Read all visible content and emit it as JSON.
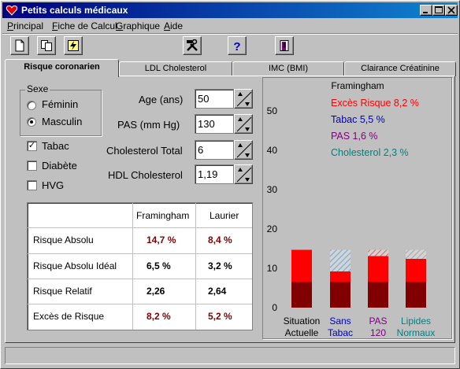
{
  "window": {
    "title": "Petits calculs médicaux"
  },
  "menu": [
    {
      "label": "Principal",
      "ul": "P"
    },
    {
      "label": "Fiche de Calcul",
      "ul": "F"
    },
    {
      "label": "Graphique",
      "ul": "G"
    },
    {
      "label": "Aide",
      "ul": "A"
    }
  ],
  "toolbar": [
    "new-document-icon",
    "copy-icon",
    "lightning-icon",
    "tools-icon",
    "help-question-icon",
    "exit-door-icon"
  ],
  "tabs": [
    {
      "label": "Risque coronarien",
      "active": true
    },
    {
      "label": "LDL Cholesterol",
      "active": false
    },
    {
      "label": "IMC (BMI)",
      "active": false
    },
    {
      "label": "Clairance Créatinine",
      "active": false
    }
  ],
  "sexe": {
    "label": "Sexe",
    "options": [
      {
        "label": "Féminin",
        "selected": false
      },
      {
        "label": "Masculin",
        "selected": true
      }
    ]
  },
  "checkboxes": [
    {
      "label": "Tabac",
      "checked": true
    },
    {
      "label": "Diabète",
      "checked": false
    },
    {
      "label": "HVG",
      "checked": false
    }
  ],
  "inputs": [
    {
      "label": "Age (ans)",
      "value": "50"
    },
    {
      "label": "PAS (mm Hg)",
      "value": "130"
    },
    {
      "label": "Cholesterol Total",
      "value": "6"
    },
    {
      "label": "HDL Cholesterol",
      "value": "1,19"
    }
  ],
  "results": {
    "headers": [
      "Framingham",
      "Laurier"
    ],
    "rows": [
      {
        "label": "Risque Absolu",
        "framingham": "14,7 %",
        "laurier": "8,4 %",
        "highlight": true
      },
      {
        "label": "Risque Absolu Idéal",
        "framingham": "6,5 %",
        "laurier": "3,2 %",
        "highlight": false
      },
      {
        "label": "Risque Relatif",
        "framingham": "2,26",
        "laurier": "2,64",
        "highlight": false
      },
      {
        "label": "Excès de Risque",
        "framingham": "8,2 %",
        "laurier": "5,2 %",
        "highlight": true
      }
    ],
    "highlight_color": "#800000"
  },
  "chart_data": {
    "type": "bar",
    "title": "Framingham",
    "legend": [
      {
        "text": "Excès Risque 8,2 %",
        "color": "#ff0000"
      },
      {
        "text": "Tabac 5,5 %",
        "color": "#0000c0"
      },
      {
        "text": "PAS 1,6 %",
        "color": "#800080"
      },
      {
        "text": "Cholesterol 2,3 %",
        "color": "#008080"
      }
    ],
    "ylim": [
      0,
      55
    ],
    "yticks": [
      0,
      10,
      20,
      30,
      40,
      50
    ],
    "categories": [
      {
        "line1": "Situation",
        "line2": "Actuelle",
        "color": "#000000"
      },
      {
        "line1": "Sans",
        "line2": "Tabac",
        "color": "#0000c0"
      },
      {
        "line1": "PAS",
        "line2": "120",
        "color": "#800080"
      },
      {
        "line1": "Lipides",
        "line2": "Normaux",
        "color": "#008080"
      }
    ],
    "series": [
      {
        "values": [
          6.5,
          6.5,
          6.5,
          6.5
        ],
        "color": "#800000"
      },
      {
        "values": [
          8.2,
          2.7,
          6.6,
          5.9
        ],
        "color": "#ff0000"
      },
      {
        "values": [
          0,
          5.5,
          1.6,
          2.3
        ],
        "color": "#c0c0c0",
        "hatch": [
          "",
          "#6fa8dc",
          "#e06666",
          "#aaaaaa"
        ]
      }
    ]
  }
}
